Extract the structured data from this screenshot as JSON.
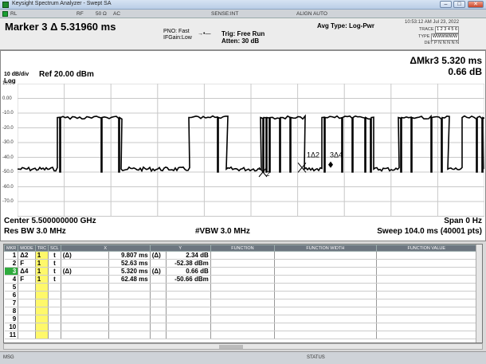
{
  "window": {
    "title": "Keysight Spectrum Analyzer - Swept SA",
    "min": "–",
    "max": "□",
    "close": "✕"
  },
  "measbar": {
    "rl": "RL",
    "rf": "RF",
    "impedance": "50 Ω",
    "coupling": "AC",
    "sense": "SENSE:INT",
    "align": "ALIGN AUTO"
  },
  "header": {
    "marker_title": "Marker 3 Δ 5.31960 ms",
    "pno": "PNO: Fast",
    "ifgain": "IFGain:Low",
    "trig": "Trig: Free Run",
    "atten": "Atten: 30 dB",
    "avg_type": "Avg Type: Log-Pwr",
    "datetime": "10:53:12 AM Jul 23, 2022",
    "trace_row": "1 2 3 4 5 6",
    "type_row": "WWWWWW",
    "det_row": "P N N N N N",
    "trace_label": "TRACE",
    "type_label": "TYPE",
    "det_label": "DET"
  },
  "display": {
    "delta_marker": "ΔMkr3 5.320 ms",
    "delta_value": "0.66 dB",
    "scale": "10 dB/div",
    "log": "Log",
    "ref": "Ref 20.00 dBm",
    "y_labels": [
      "10.0",
      "0.00",
      "-10.0",
      "-20.0",
      "-30.0",
      "-40.0",
      "-50.0",
      "-60.0",
      "-70.0"
    ],
    "center": "Center 5.500000000 GHz",
    "res_bw": "Res BW 3.0 MHz",
    "vbw": "#VBW 3.0 MHz",
    "span": "Span 0 Hz",
    "sweep": "Sweep  104.0 ms (40001 pts)",
    "markers": {
      "m1": "1Δ2",
      "m3": "3Δ4",
      "m2": "2",
      "m4": "4"
    }
  },
  "marker_table": {
    "headers": [
      "MKR",
      "MODE",
      "TRC",
      "SCL",
      "X",
      "Y",
      "FUNCTION",
      "FUNCTION WIDTH",
      "FUNCTION VALUE"
    ],
    "rows": [
      {
        "num": "1",
        "mode": "Δ2",
        "trc": "1",
        "scl": "t",
        "xmode": "(Δ)",
        "x": "9.807 ms",
        "ymode": "(Δ)",
        "y": "2.34 dB"
      },
      {
        "num": "2",
        "mode": "F",
        "trc": "1",
        "scl": "t",
        "xmode": "",
        "x": "52.63 ms",
        "ymode": "",
        "y": "-52.38 dBm"
      },
      {
        "num": "3",
        "mode": "Δ4",
        "trc": "1",
        "scl": "t",
        "xmode": "(Δ)",
        "x": "5.320 ms",
        "ymode": "(Δ)",
        "y": "0.66 dB"
      },
      {
        "num": "4",
        "mode": "F",
        "trc": "1",
        "scl": "t",
        "xmode": "",
        "x": "62.48 ms",
        "ymode": "",
        "y": "-50.66 dBm"
      },
      {
        "num": "5",
        "mode": "",
        "trc": "",
        "scl": "",
        "xmode": "",
        "x": "",
        "ymode": "",
        "y": ""
      },
      {
        "num": "6",
        "mode": "",
        "trc": "",
        "scl": "",
        "xmode": "",
        "x": "",
        "ymode": "",
        "y": ""
      },
      {
        "num": "7",
        "mode": "",
        "trc": "",
        "scl": "",
        "xmode": "",
        "x": "",
        "ymode": "",
        "y": ""
      },
      {
        "num": "8",
        "mode": "",
        "trc": "",
        "scl": "",
        "xmode": "",
        "x": "",
        "ymode": "",
        "y": ""
      },
      {
        "num": "9",
        "mode": "",
        "trc": "",
        "scl": "",
        "xmode": "",
        "x": "",
        "ymode": "",
        "y": ""
      },
      {
        "num": "10",
        "mode": "",
        "trc": "",
        "scl": "",
        "xmode": "",
        "x": "",
        "ymode": "",
        "y": ""
      },
      {
        "num": "11",
        "mode": "",
        "trc": "",
        "scl": "",
        "xmode": "",
        "x": "",
        "ymode": "",
        "y": ""
      }
    ]
  },
  "statusbar": {
    "msg": "MSG",
    "status": "STATUS"
  },
  "colors": {
    "trace": "#000000",
    "grid": "#c8c8c8",
    "selected_marker": "#2eab3d",
    "trc_cell": "#fff86a"
  }
}
